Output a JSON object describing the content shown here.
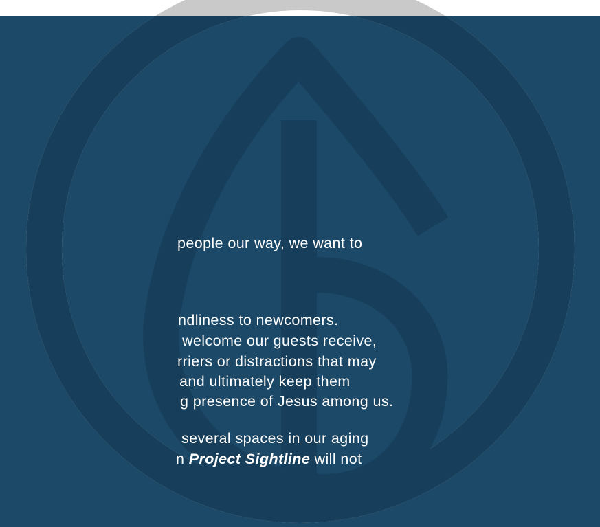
{
  "colors": {
    "panel_background": "#1c4968",
    "emblem_dark": "#173f5b",
    "emblem_light": "#c9c9c9",
    "text": "#ffffff"
  },
  "emblem": {
    "name": "leaf-emblem-icon"
  },
  "paragraphs": [
    {
      "lines": [
        "people our way, we want to"
      ]
    },
    {
      "lines": [
        "ndliness to newcomers.",
        "welcome our guests receive,",
        "rriers or distractions that may",
        "and ultimately keep them",
        "g presence of Jesus among us."
      ]
    },
    {
      "lines": [
        "several spaces in our aging"
      ]
    }
  ],
  "sightline_line": {
    "prefix": "n ",
    "emphasis": "Project Sightline",
    "suffix": " will not"
  }
}
